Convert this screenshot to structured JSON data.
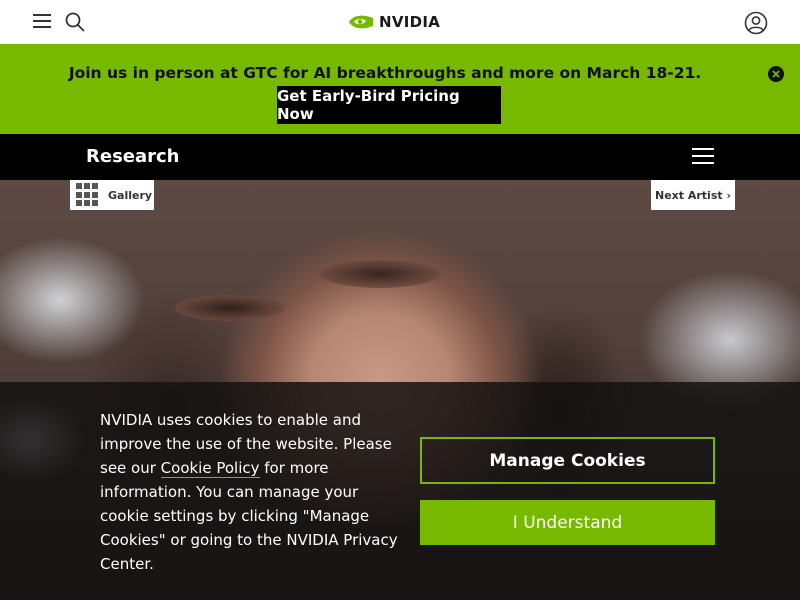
{
  "header": {
    "logo_text": "NVIDIA",
    "menu_icon": "menu-icon",
    "search_icon": "search-icon",
    "account_icon": "account-icon"
  },
  "promo": {
    "text": "Join us in person at GTC for AI breakthroughs and more on March 18-21.",
    "cta_label": "Get Early-Bird Pricing Now",
    "close_icon": "close-icon"
  },
  "research_nav": {
    "title": "Research",
    "menu_icon": "hamburger-icon"
  },
  "hero": {
    "gallery_label": "Gallery",
    "next_label": "Next Artist ›"
  },
  "cookie_banner": {
    "text_before_link": "NVIDIA uses cookies to enable and improve the use of the website. Please see our ",
    "link_text": "Cookie Policy",
    "text_after_link": " for more information. You can manage your cookie settings by clicking \"Manage Cookies\" or going to the NVIDIA Privacy Center.",
    "manage_label": "Manage Cookies",
    "accept_label": "I Understand"
  },
  "colors": {
    "brand_green": "#76b900",
    "black": "#000000",
    "white": "#ffffff"
  }
}
